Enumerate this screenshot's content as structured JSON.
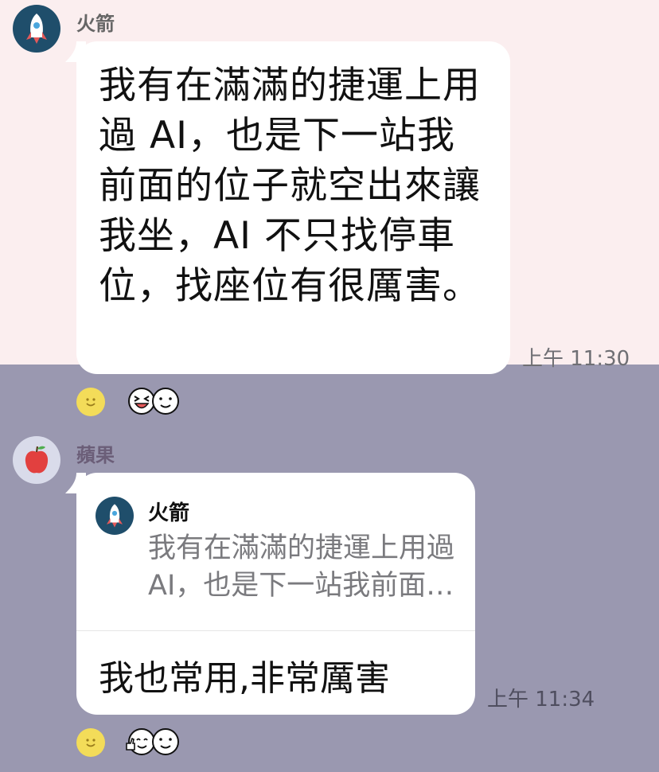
{
  "messages": [
    {
      "sender": "火箭",
      "avatar_icon": "rocket-icon",
      "text": "我有在滿滿的捷運上用過 AI，也是下一站我前面的位子就空出來讓我坐，AI 不只找停車位，找座位有很厲害。",
      "time": "上午 11:30",
      "reactions": [
        "laughing-face-icon",
        "smiling-face-icon"
      ]
    },
    {
      "sender": "蘋果",
      "avatar_icon": "apple-icon",
      "reply": {
        "sender": "火箭",
        "avatar_icon": "rocket-icon",
        "preview": "我有在滿滿的捷運上用過 AI，也是下一站我前面的位子就空出來讓我坐"
      },
      "text": "我也常用,非常厲害",
      "time": "上午 11:34",
      "reactions": [
        "thumbs-up-face-icon",
        "smiling-face-icon"
      ]
    }
  ],
  "colors": {
    "highlight_background": "#fbeeef",
    "chat_background": "#9a98b0",
    "bubble": "#ffffff",
    "rocket_avatar": "#1f4e6b",
    "reaction_button": "#f3dc59"
  }
}
